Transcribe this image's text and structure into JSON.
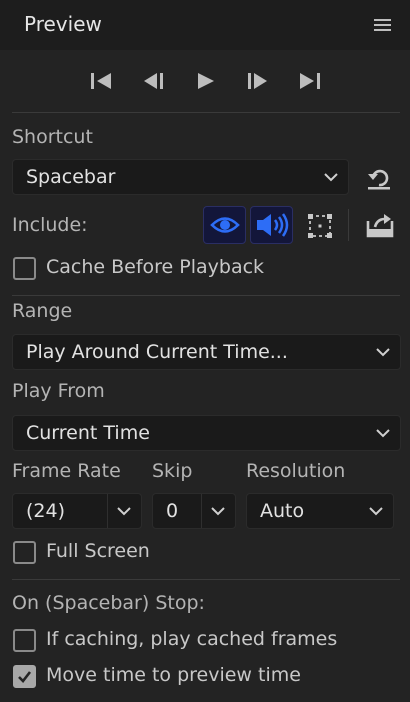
{
  "panel": {
    "title": "Preview",
    "menu_icon": "hamburger-icon"
  },
  "transport": {
    "icons": [
      "skip-to-start-icon",
      "step-back-icon",
      "play-icon",
      "step-forward-icon",
      "skip-to-end-icon"
    ]
  },
  "shortcut": {
    "label": "Shortcut",
    "value": "Spacebar",
    "reset_icon": "reset-icon"
  },
  "include": {
    "label": "Include:",
    "video_icon": "eye-icon",
    "video_on": true,
    "audio_icon": "speaker-icon",
    "audio_on": true,
    "overlay_icon": "frame-overlay-icon",
    "overlay_on": false,
    "export_icon": "export-icon"
  },
  "cache_before_playback": {
    "label": "Cache Before Playback",
    "checked": false
  },
  "range": {
    "label": "Range",
    "value": "Play Around Current Time..."
  },
  "play_from": {
    "label": "Play From",
    "value": "Current Time"
  },
  "frame_rate": {
    "label": "Frame Rate",
    "value": "(24)"
  },
  "skip": {
    "label": "Skip",
    "value": "0"
  },
  "resolution": {
    "label": "Resolution",
    "value": "Auto"
  },
  "full_screen": {
    "label": "Full Screen",
    "checked": false
  },
  "on_stop": {
    "label": "On (Spacebar) Stop:",
    "cached_frames": {
      "label": "If caching, play cached frames",
      "checked": false
    },
    "move_time": {
      "label": "Move time to preview time",
      "checked": true
    }
  },
  "colors": {
    "accent": "#2d6df6",
    "background": "#232323",
    "field": "#1a1a1a"
  }
}
